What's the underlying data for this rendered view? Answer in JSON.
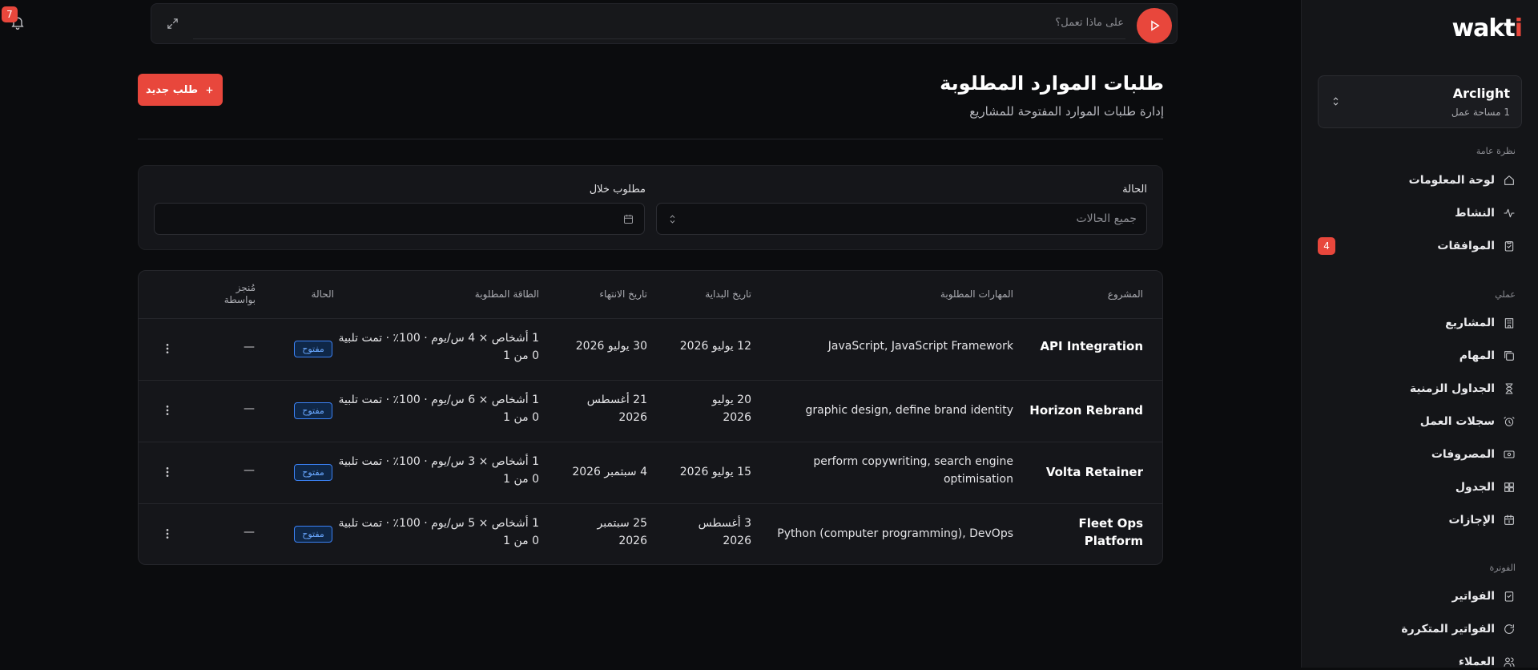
{
  "notifications": {
    "count": "7"
  },
  "askbar": {
    "placeholder": "على ماذا تعمل؟"
  },
  "sidebar": {
    "logo_main": "wakt",
    "logo_last": "i",
    "workspace": {
      "name": "Arclight",
      "sub": "1 مساحة عمل"
    },
    "sections": {
      "overview": "نظرة عامة",
      "mine": "عملي",
      "billing": "الفوترة"
    },
    "items": [
      {
        "label": "لوحة المعلومات",
        "icon": "home-icon"
      },
      {
        "label": "النشاط",
        "icon": "activity-icon"
      },
      {
        "label": "الموافقات",
        "icon": "clipboard-check-icon",
        "badge": "4"
      },
      {
        "label": "المشاريع",
        "icon": "building-icon"
      },
      {
        "label": "المهام",
        "icon": "tasks-icon"
      },
      {
        "label": "الجداول الزمنية",
        "icon": "hourglass-icon"
      },
      {
        "label": "سجلات العمل",
        "icon": "alarm-clock-icon"
      },
      {
        "label": "المصروفات",
        "icon": "money-icon"
      },
      {
        "label": "الجدول",
        "icon": "grid-icon"
      },
      {
        "label": "الإجازات",
        "icon": "calendar-leave-icon"
      },
      {
        "label": "الفواتير",
        "icon": "invoice-icon"
      },
      {
        "label": "الفواتير المتكررة",
        "icon": "refresh-icon"
      },
      {
        "label": "العملاء",
        "icon": "users-icon"
      }
    ]
  },
  "page": {
    "title": "طلبات الموارد المطلوبة",
    "subtitle": "إدارة طلبات الموارد المفتوحة للمشاريع",
    "new_button": "طلب جديد"
  },
  "filters": {
    "status_label": "الحالة",
    "status_placeholder": "جميع الحالات",
    "needed_label": "مطلوب خلال"
  },
  "table": {
    "headers": {
      "project": "المشروع",
      "skills": "المهارات المطلوبة",
      "start": "تاريخ البداية",
      "end": "تاريخ الانتهاء",
      "capacity": "الطاقة المطلوبة",
      "status": "الحالة",
      "fulfilled_by_1": "مُنجز",
      "fulfilled_by_2": "بواسطة"
    },
    "rows": [
      {
        "project_1": "API Integration",
        "project_2": "",
        "skills_1": "JavaScript, JavaScript Framework",
        "skills_2": "",
        "start_1": "12 يوليو 2026",
        "start_2": "",
        "end_1": "30 يوليو 2026",
        "end_2": "",
        "cap_1": "1 أشخاص × 4 س/يوم · 100٪ · تمت تلبية",
        "cap_2": "0 من 1",
        "status": "مفتوح",
        "by": "—"
      },
      {
        "project_1": "Horizon Rebrand",
        "project_2": "",
        "skills_1": "graphic design, define brand identity",
        "skills_2": "",
        "start_1": "20 يوليو",
        "start_2": "2026",
        "end_1": "21 أغسطس",
        "end_2": "2026",
        "cap_1": "1 أشخاص × 6 س/يوم · 100٪ · تمت تلبية",
        "cap_2": "0 من 1",
        "status": "مفتوح",
        "by": "—"
      },
      {
        "project_1": "Volta Retainer",
        "project_2": "",
        "skills_1": "perform copywriting, search engine",
        "skills_2": "optimisation",
        "start_1": "15 يوليو 2026",
        "start_2": "",
        "end_1": "4 سبتمبر 2026",
        "end_2": "",
        "cap_1": "1 أشخاص × 3 س/يوم · 100٪ · تمت تلبية",
        "cap_2": "0 من 1",
        "status": "مفتوح",
        "by": "—"
      },
      {
        "project_1": "Fleet Ops",
        "project_2": "Platform",
        "skills_1": "Python (computer programming), DevOps",
        "skills_2": "",
        "start_1": "3 أغسطس",
        "start_2": "2026",
        "end_1": "25 سبتمبر",
        "end_2": "2026",
        "cap_1": "1 أشخاص × 5 س/يوم · 100٪ · تمت تلبية",
        "cap_2": "0 من 1",
        "status": "مفتوح",
        "by": "—"
      }
    ]
  },
  "colors": {
    "accent": "#e8473c",
    "status_open": "#3b82f6"
  }
}
